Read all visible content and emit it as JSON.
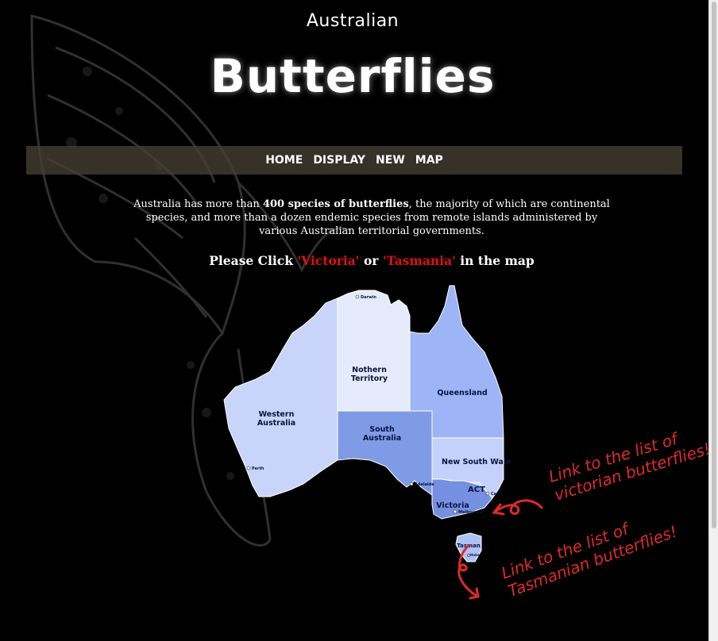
{
  "header": {
    "title_small": "Australian",
    "title_big": "Butterflies"
  },
  "nav": {
    "items": [
      "HOME",
      "DISPLAY",
      "NEW",
      "MAP"
    ]
  },
  "intro": {
    "part1": "Australia has more than ",
    "bold": "400 species of butterflies",
    "part2": ", the majority of which are continental species, and more than a dozen endemic species from remote islands administered by various Australian territorial governments."
  },
  "instruction": {
    "prefix": "Please Click ",
    "link_victoria": "'Victoria'",
    "middle": " or ",
    "link_tasmania": "'Tasmania'",
    "suffix": " in the map"
  },
  "map": {
    "states": {
      "wa": "Western Australia",
      "nt": "Nothern Territory",
      "sa": "South Australia",
      "qld": "Queensland",
      "nsw": "New South Wale",
      "act": "ACT",
      "vic": "Victoria",
      "tas": "Tasman"
    },
    "cities": {
      "darwin": "Darwin",
      "perth": "Perth",
      "adelaide": "Adelaide",
      "melbourne": "Melbourne",
      "canberra": "Canb",
      "hobart": "Hobart"
    },
    "colors": {
      "wa": "#c9d4fa",
      "nt": "#e6ebfc",
      "sa": "#7f9be6",
      "qld": "#9db4f7",
      "nsw": "#c4d1fb",
      "act": "#c9d4fa",
      "vic": "#7590e0",
      "tas": "#aec2f5",
      "label": "#0a1440"
    }
  },
  "annotations": {
    "victoria_line1": "Link to the list of",
    "victoria_line2": "victorian butterflies!",
    "tasmania_line1": "Link to the list of",
    "tasmania_line2": "Tasmanian butterflies!",
    "color": "#e02a2a"
  }
}
